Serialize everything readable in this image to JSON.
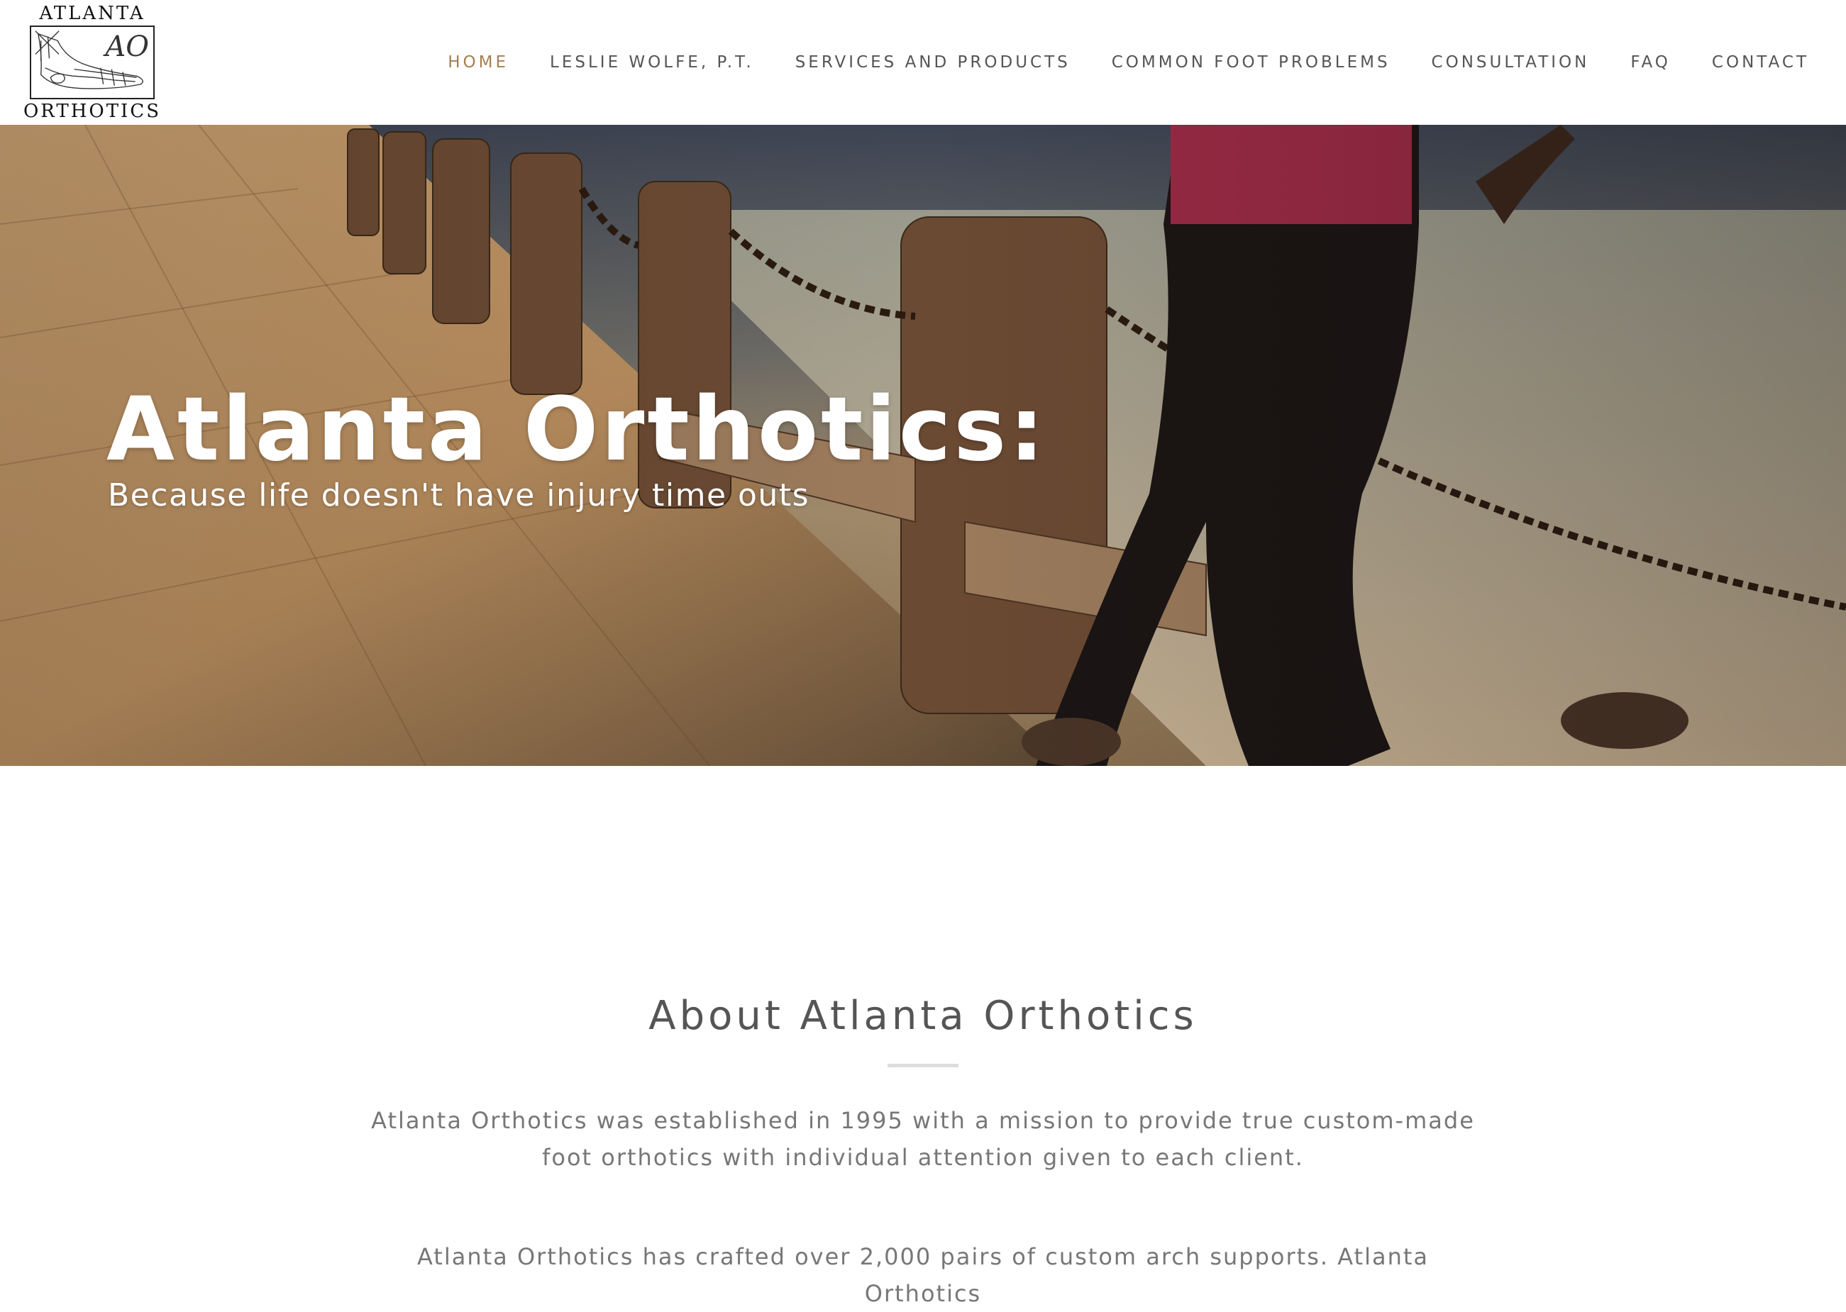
{
  "logo": {
    "top_text": "ATLANTA",
    "bottom_text": "ORTHOTICS",
    "monogram": "AO"
  },
  "nav": {
    "items": [
      {
        "label": "HOME",
        "active": true
      },
      {
        "label": "LESLIE WOLFE, P.T.",
        "active": false
      },
      {
        "label": "SERVICES AND PRODUCTS",
        "active": false
      },
      {
        "label": "COMMON FOOT PROBLEMS",
        "active": false
      },
      {
        "label": "CONSULTATION",
        "active": false
      },
      {
        "label": "FAQ",
        "active": false
      },
      {
        "label": "CONTACT",
        "active": false
      }
    ],
    "active_color": "#a67f4f",
    "color": "#555555"
  },
  "hero": {
    "title": "Atlanta Orthotics:",
    "subtitle": "Because life doesn't have injury time outs"
  },
  "about": {
    "title": "About Atlanta Orthotics",
    "paragraph1": "Atlanta Orthotics was established in 1995 with a mission to provide true custom-made foot orthotics with individual attention given to each client.",
    "paragraph2": "Atlanta Orthotics has crafted over 2,000 pairs of custom arch supports. Atlanta Orthotics"
  }
}
